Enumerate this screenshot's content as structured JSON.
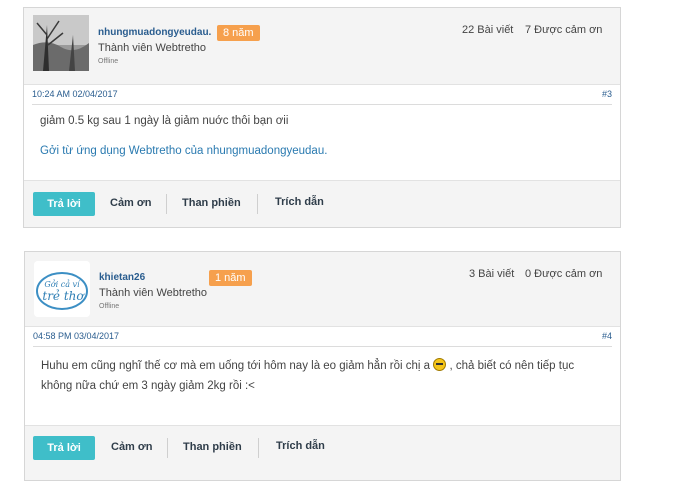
{
  "posts": [
    {
      "username": "nhungmuadongyeudau.",
      "badge": "8 năm",
      "rank": "Thành viên Webtretho",
      "status": "Offline",
      "posts_stat": "22 Bài viết",
      "thanks_stat": "7 Được cảm ơn",
      "time": "10:24 AM 02/04/2017",
      "number": "#3",
      "content_line1": "giảm 0.5 kg sau 1 ngày là giảm nuớc thôi bạn ơii",
      "content_line2": "Gởi từ ứng dụng Webtretho của nhungmuadongyeudau.",
      "reply_label": "Trả lời",
      "thanks_label": "Cảm ơn",
      "complain_label": "Than phiền",
      "quote_label": "Trích dẫn"
    },
    {
      "username": "khietan26",
      "badge": "1 năm",
      "rank": "Thành viên Webtretho",
      "status": "Offline",
      "posts_stat": "3 Bài viết",
      "thanks_stat": "0 Được cảm ơn",
      "time": "04:58 PM 03/04/2017",
      "number": "#4",
      "content_line1a": "Huhu em cũng nghĩ thế cơ mà em uống tới hôm nay là eo giảm hẳn rồi chị a",
      "content_line1b": ", chả biết có nên tiếp tục",
      "content_line2": "không nữa chứ em 3 ngày giảm 2kg rồi :<",
      "avatar_text1": "Gởi cả ví",
      "avatar_text2": "trẻ thơ",
      "reply_label": "Trả lời",
      "thanks_label": "Cảm ơn",
      "complain_label": "Than phiền",
      "quote_label": "Trích dẫn"
    }
  ]
}
